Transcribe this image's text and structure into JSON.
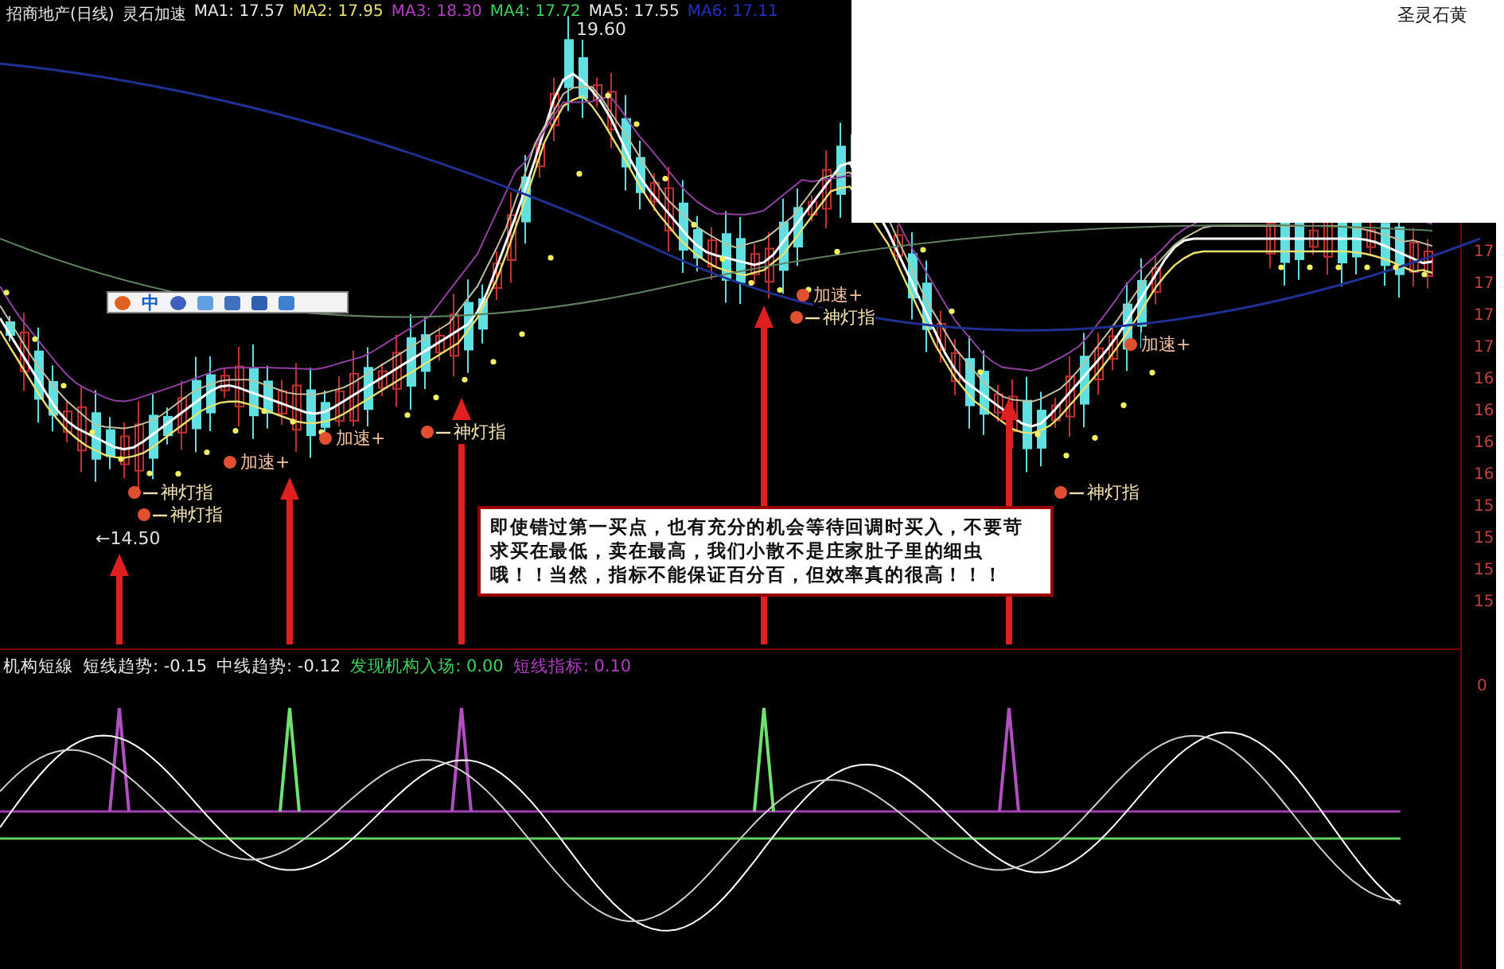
{
  "chart_header": {
    "title": "招商地产(日线)",
    "indicator": "灵石加速",
    "averages": [
      {
        "label": "MA1: 17.57",
        "color": "#e8e8e8"
      },
      {
        "label": "MA2: 17.95",
        "color": "#e8e070"
      },
      {
        "label": "MA3: 18.30",
        "color": "#b040c0"
      },
      {
        "label": "MA4: 17.72",
        "color": "#40d060"
      },
      {
        "label": "MA5: 17.55",
        "color": "#e8e8e8"
      },
      {
        "label": "MA6: 17.11",
        "color": "#2030c0"
      }
    ],
    "right_label": "圣灵石黄"
  },
  "toolbar": {
    "label": "中"
  },
  "price_marks": [
    {
      "kind": "high",
      "text": "19.60"
    },
    {
      "kind": "low",
      "text": "←14.50"
    }
  ],
  "signals": [
    {
      "kind": "lamp",
      "text": "神灯指"
    },
    {
      "kind": "lamp",
      "text": "神灯指"
    },
    {
      "kind": "accel",
      "text": "加速+"
    },
    {
      "kind": "accel",
      "text": "加速+"
    },
    {
      "kind": "lamp",
      "text": "神灯指"
    },
    {
      "kind": "accel",
      "text": "加速+"
    },
    {
      "kind": "lamp",
      "text": "神灯指"
    },
    {
      "kind": "accel",
      "text": "加速+"
    },
    {
      "kind": "lamp",
      "text": "神灯指"
    }
  ],
  "callout": "即使错过第一买点，也有充分的机会等待回调时买入，不要苛求买在最低，卖在最高，我们小散不是庄家肚子里的细虫哦！！当然，指标不能保证百分百，但效率真的很高！！！",
  "indicator_header": [
    {
      "label": "机构短線",
      "color": "#e8e8e8"
    },
    {
      "label": "短线趋势: -0.15",
      "color": "#e8e8e8"
    },
    {
      "label": "中线趋势: -0.12",
      "color": "#e8e8e8"
    },
    {
      "label": "发现机构入场: 0.00",
      "color": "#40d060"
    },
    {
      "label": "短线指标: 0.10",
      "color": "#b040c0"
    }
  ],
  "price_axis": [
    "17",
    "17",
    "17",
    "17",
    "16",
    "16",
    "16",
    "16",
    "15",
    "15",
    "15",
    "15"
  ],
  "indicator_axis": [
    "0"
  ]
}
